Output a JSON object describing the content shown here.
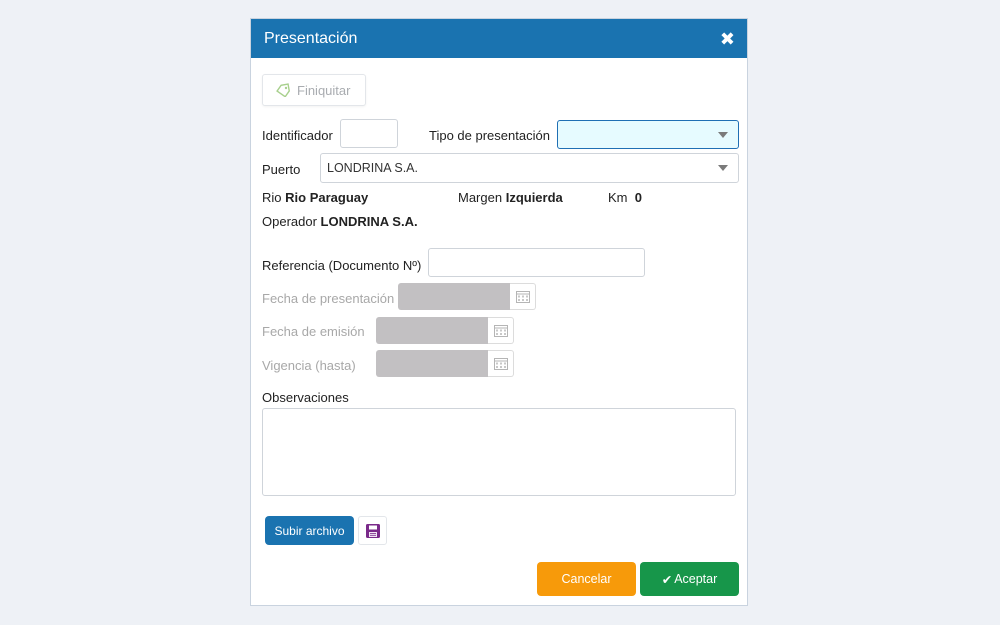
{
  "dialog": {
    "title": "Presentación",
    "close_icon": "close-icon"
  },
  "toolbar": {
    "finiquitar_label": "Finiquitar",
    "finiquitar_icon": "tag-icon"
  },
  "form": {
    "identificador_label": "Identificador",
    "identificador_value": "",
    "tipo_label": "Tipo de presentación",
    "tipo_value": "",
    "puerto_label": "Puerto",
    "puerto_value": "LONDRINA S.A.",
    "rio_label": "Rio",
    "rio_value": "Rio Paraguay",
    "margen_label": "Margen",
    "margen_value": "Izquierda",
    "km_label": "Km",
    "km_value": "0",
    "operador_label": "Operador",
    "operador_value": "LONDRINA S.A.",
    "referencia_label": "Referencia (Documento Nº)",
    "referencia_value": "",
    "fecha_presentacion_label": "Fecha de presentación",
    "fecha_emision_label": "Fecha de emisión",
    "vigencia_label": "Vigencia (hasta)",
    "observaciones_label": "Observaciones",
    "observaciones_value": ""
  },
  "footer": {
    "subir_label": "Subir archivo",
    "save_icon": "floppy-disk-icon",
    "cancel_label": "Cancelar",
    "accept_label": "Aceptar",
    "accept_icon": "checkmark-icon"
  },
  "colors": {
    "header": "#1a73b0",
    "cancel": "#f79a0a",
    "accept": "#17964a",
    "disabled_field": "#c2c0c2",
    "tipo_bg": "#e6fbff"
  }
}
